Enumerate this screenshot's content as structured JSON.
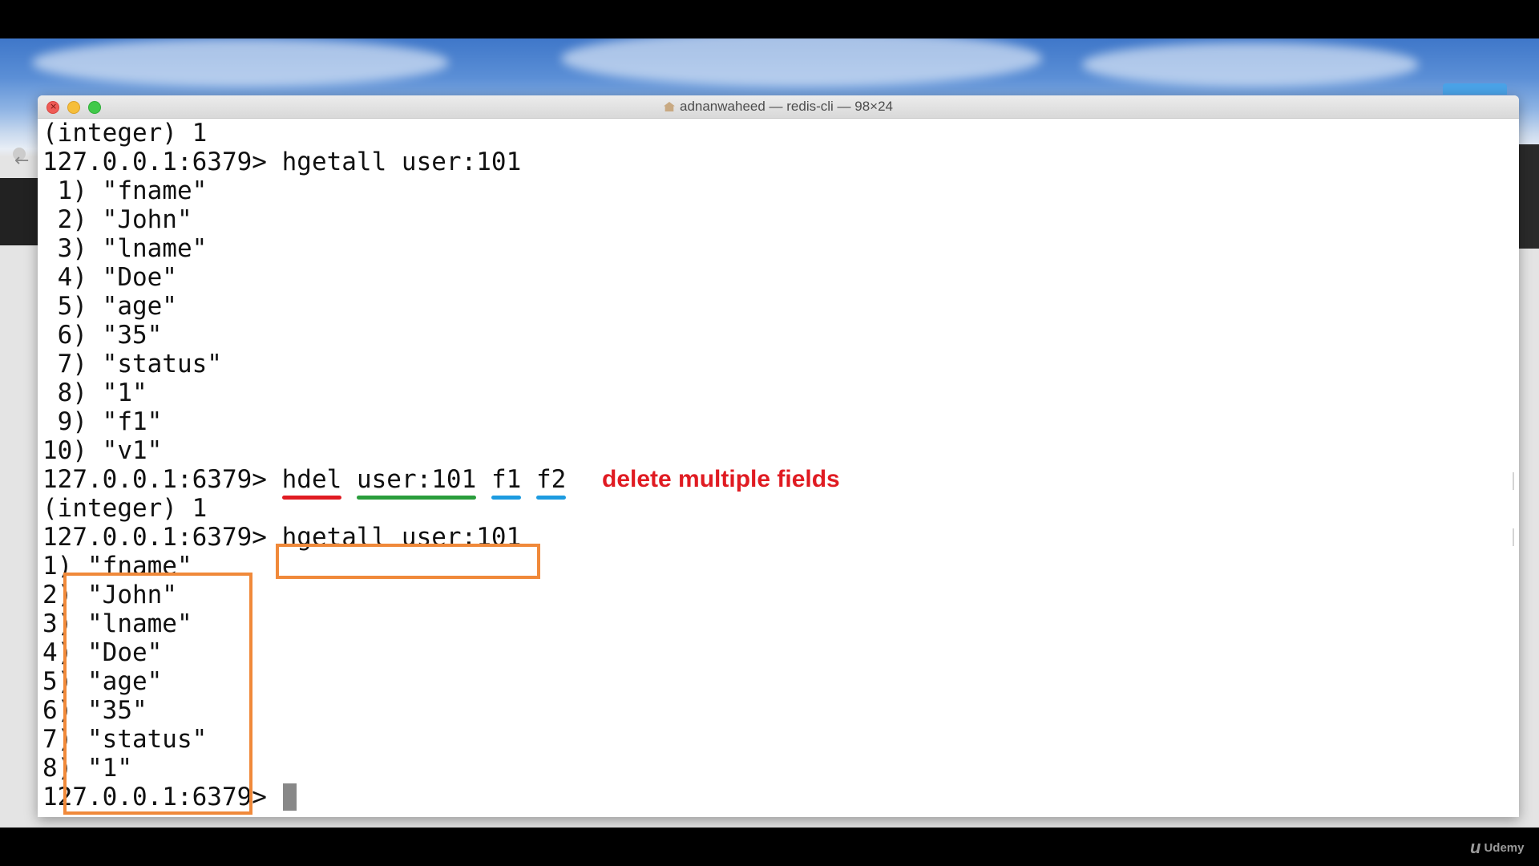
{
  "window": {
    "title": "adnanwaheed — redis-cli — 98×24"
  },
  "terminal": {
    "lines": [
      "(integer) 1",
      "127.0.0.1:6379> hgetall user:101",
      " 1) \"fname\"",
      " 2) \"John\"",
      " 3) \"lname\"",
      " 4) \"Doe\"",
      " 5) \"age\"",
      " 6) \"35\"",
      " 7) \"status\"",
      " 8) \"1\"",
      " 9) \"f1\"",
      "10) \"v1\"",
      "(integer) 1",
      "127.0.0.1:6379> hgetall user:101 ",
      "1) \"fname\"",
      "2) \"John\"",
      "3) \"lname\"",
      "4) \"Doe\"",
      "5) \"age\"",
      "6) \"35\"",
      "7) \"status\"",
      "8) \"1\""
    ],
    "hdel_line": {
      "prompt": "127.0.0.1:6379> ",
      "command": "hdel",
      "key": "user:101",
      "field1": "f1",
      "field2": "f2"
    },
    "last_prompt": "127.0.0.1:6379>"
  },
  "annotations": {
    "note": "delete multiple fields",
    "underline_colors": {
      "command": "#e01b22",
      "key": "#2a9d3c",
      "fields": "#1d9be0"
    },
    "box_color": "#f0893a"
  },
  "watermark": {
    "text": "Udemy"
  }
}
